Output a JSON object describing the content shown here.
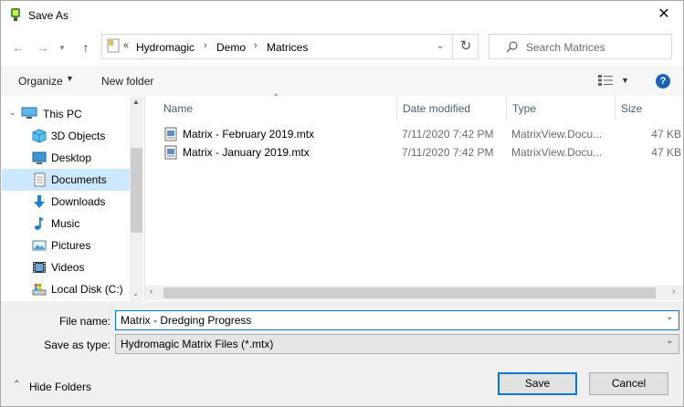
{
  "window": {
    "title": "Save As"
  },
  "nav": {
    "overflow": "«",
    "breadcrumbs": [
      "Hydromagic",
      "Demo",
      "Matrices"
    ],
    "search_placeholder": "Search Matrices"
  },
  "toolbar": {
    "organize": "Organize",
    "new_folder": "New folder"
  },
  "sidebar": {
    "items": [
      {
        "label": "This PC",
        "icon": "computer-icon"
      },
      {
        "label": "3D Objects",
        "icon": "cube-icon"
      },
      {
        "label": "Desktop",
        "icon": "desktop-icon"
      },
      {
        "label": "Documents",
        "icon": "document-icon",
        "selected": true
      },
      {
        "label": "Downloads",
        "icon": "download-icon"
      },
      {
        "label": "Music",
        "icon": "music-icon"
      },
      {
        "label": "Pictures",
        "icon": "pictures-icon"
      },
      {
        "label": "Videos",
        "icon": "videos-icon"
      },
      {
        "label": "Local Disk (C:)",
        "icon": "disk-icon"
      }
    ]
  },
  "columns": {
    "name": "Name",
    "date": "Date modified",
    "type": "Type",
    "size": "Size"
  },
  "files": [
    {
      "name": "Matrix - February 2019.mtx",
      "date": "7/11/2020 7:42 PM",
      "type": "MatrixView.Docu...",
      "size": "47 KB"
    },
    {
      "name": "Matrix - January 2019.mtx",
      "date": "7/11/2020 7:42 PM",
      "type": "MatrixView.Docu...",
      "size": "47 KB"
    }
  ],
  "form": {
    "filename_label": "File name:",
    "filename_value": "Matrix - Dredging Progress",
    "type_label": "Save as type:",
    "type_value": "Hydromagic Matrix Files (*.mtx)"
  },
  "footer": {
    "hide_folders": "Hide Folders",
    "save": "Save",
    "cancel": "Cancel"
  },
  "colors": {
    "accent": "#0078d7",
    "selection": "#cce8ff",
    "help": "#1c64b8"
  }
}
